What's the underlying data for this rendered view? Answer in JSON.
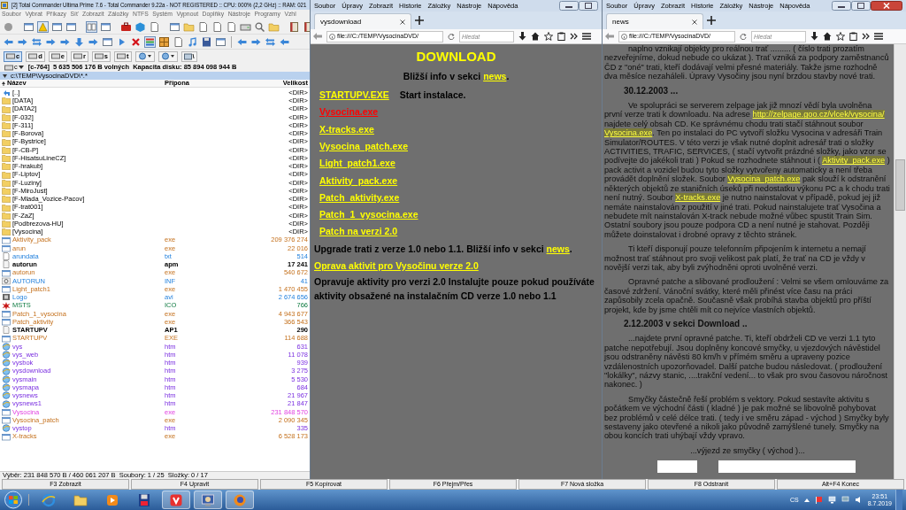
{
  "total_commander": {
    "title": "[2] Total Commander Ultima Prime 7.6 - Total Commander 9.22a - NOT REGISTERED :: CPU: 000% (2,2 GHz) :: RAM: 021",
    "menu": [
      "Soubor",
      "Vybrat",
      "Příkazy",
      "Síť",
      "Zobrazit",
      "Záložky",
      "NTFS",
      "Systém",
      "Vypnout",
      "Doplňky",
      "Nástroje",
      "Programy",
      "Vzhl"
    ],
    "drives": [
      {
        "label": "c",
        "selected": true
      },
      {
        "label": "d",
        "selected": false
      },
      {
        "label": "e",
        "selected": false
      },
      {
        "label": "r",
        "selected": false
      },
      {
        "label": "s",
        "selected": false
      },
      {
        "label": "t",
        "selected": false
      }
    ],
    "root_button": "\\",
    "drive_combo": "c",
    "free_space": "[c-764]  5 635 506 176 B volných  Kapacita disku: 85 894 098 944 B",
    "path": "c:\\TEMP\\VysocinaDVD\\*.*",
    "columns": [
      "Název",
      "Přípona",
      "Velikost"
    ],
    "files": [
      {
        "name": "[..]",
        "size": "<DIR>",
        "kind": "parent",
        "selected": false
      },
      {
        "name": "[DATA]",
        "size": "<DIR>",
        "kind": "folder",
        "selected": false
      },
      {
        "name": "[DATA2]",
        "size": "<DIR>",
        "kind": "folder",
        "selected": false
      },
      {
        "name": "[F-032]",
        "size": "<DIR>",
        "kind": "folder",
        "selected": false
      },
      {
        "name": "[F-311]",
        "size": "<DIR>",
        "kind": "folder",
        "selected": false
      },
      {
        "name": "[F-Borova]",
        "size": "<DIR>",
        "kind": "folder",
        "selected": false
      },
      {
        "name": "[F-Bystrice]",
        "size": "<DIR>",
        "kind": "folder",
        "selected": false
      },
      {
        "name": "[F-CB-P]",
        "size": "<DIR>",
        "kind": "folder",
        "selected": false
      },
      {
        "name": "[F-HisatsuLineCZ]",
        "size": "<DIR>",
        "kind": "folder",
        "selected": false
      },
      {
        "name": "[F-hrakub]",
        "size": "<DIR>",
        "kind": "folder",
        "selected": false
      },
      {
        "name": "[F-Liptov]",
        "size": "<DIR>",
        "kind": "folder",
        "selected": false
      },
      {
        "name": "[F-Luziny]",
        "size": "<DIR>",
        "kind": "folder",
        "selected": false
      },
      {
        "name": "[F-MiroJust]",
        "size": "<DIR>",
        "kind": "folder",
        "selected": false
      },
      {
        "name": "[F-Mlada_Vozice-Pacov]",
        "size": "<DIR>",
        "kind": "folder",
        "selected": false
      },
      {
        "name": "[F-trat001]",
        "size": "<DIR>",
        "kind": "folder",
        "selected": false
      },
      {
        "name": "[F-ZaZ]",
        "size": "<DIR>",
        "kind": "folder",
        "selected": false
      },
      {
        "name": "[Podbrezova-HU]",
        "size": "<DIR>",
        "kind": "folder",
        "selected": false
      },
      {
        "name": "[Vysocina]",
        "size": "<DIR>",
        "kind": "folder",
        "selected": false
      },
      {
        "name": "Aktivity_pack",
        "ext": "exe",
        "size": "209 376 274",
        "kind": "program",
        "selected": false
      },
      {
        "name": "arun",
        "ext": "exe",
        "size": "22 016",
        "kind": "program",
        "selected": false
      },
      {
        "name": "arundata",
        "ext": "txt",
        "size": "514",
        "kind": "text",
        "selected": false
      },
      {
        "name": "autorun",
        "ext": "apm",
        "size": "17 241",
        "kind": "document",
        "selected": false
      },
      {
        "name": "autorun",
        "ext": "exe",
        "size": "540 672",
        "kind": "program",
        "selected": false
      },
      {
        "name": "AUTORUN",
        "ext": "INF",
        "size": "41",
        "kind": "settings",
        "selected": false
      },
      {
        "name": "Light_patch1",
        "ext": "exe",
        "size": "1 470 455",
        "kind": "program",
        "selected": false
      },
      {
        "name": "Logo",
        "ext": "avi",
        "size": "2 674 656",
        "kind": "video",
        "selected": false
      },
      {
        "name": "MSTS",
        "ext": "ICO",
        "size": "766",
        "kind": "image",
        "selected": false
      },
      {
        "name": "Patch_1_vysocina",
        "ext": "exe",
        "size": "4 943 677",
        "kind": "program",
        "selected": false
      },
      {
        "name": "Patch_aktivity",
        "ext": "exe",
        "size": "366 543",
        "kind": "program",
        "selected": false
      },
      {
        "name": "STARTUPV",
        "ext": "AP1",
        "size": "290",
        "kind": "document",
        "selected": false
      },
      {
        "name": "STARTUPV",
        "ext": "EXE",
        "size": "114 688",
        "kind": "program",
        "selected": false
      },
      {
        "name": "vys",
        "ext": "htm",
        "size": "631",
        "kind": "webpage",
        "selected": false
      },
      {
        "name": "vys_web",
        "ext": "htm",
        "size": "11 078",
        "kind": "webpage",
        "selected": false
      },
      {
        "name": "vysbok",
        "ext": "htm",
        "size": "939",
        "kind": "webpage",
        "selected": false
      },
      {
        "name": "vysdownload",
        "ext": "htm",
        "size": "3 275",
        "kind": "webpage",
        "selected": false
      },
      {
        "name": "vysmain",
        "ext": "htm",
        "size": "5 530",
        "kind": "webpage",
        "selected": false
      },
      {
        "name": "vysmapa",
        "ext": "htm",
        "size": "684",
        "kind": "webpage",
        "selected": false
      },
      {
        "name": "vysnews",
        "ext": "htm",
        "size": "21 967",
        "kind": "webpage",
        "selected": false
      },
      {
        "name": "vysnews1",
        "ext": "htm",
        "size": "21 847",
        "kind": "webpage",
        "selected": false
      },
      {
        "name": "Vysocina",
        "ext": "exe",
        "size": "231 848 570",
        "kind": "program",
        "selected": true
      },
      {
        "name": "Vysocina_patch",
        "ext": "exe",
        "size": "2 090 345",
        "kind": "program",
        "selected": false
      },
      {
        "name": "vystop",
        "ext": "htm",
        "size": "335",
        "kind": "webpage",
        "selected": false
      },
      {
        "name": "X-tracks",
        "ext": "exe",
        "size": "6 528 173",
        "kind": "program",
        "selected": false
      }
    ],
    "status": "Výběr: 231 848 570 B / 460 061 207 B  Soubory: 1 / 25  Složky: 0 / 17",
    "function_keys": [
      "F3 Zobrazit",
      "F4 Upravit",
      "F5 Kopírovat",
      "F6 Přejm/Přes",
      "F7 Nová složka",
      "F8 Odstranit",
      "Alt+F4 Konec"
    ]
  },
  "browsers": [
    {
      "menu": [
        "Soubor",
        "Úpravy",
        "Zobrazit",
        "Historie",
        "Záložky",
        "Nástroje",
        "Nápověda"
      ],
      "tab": "vysdownload",
      "url": "file:///C:/TEMP/VysocinaDVD/",
      "search_placeholder": "Hledat",
      "close_button": false
    },
    {
      "menu": [
        "Soubor",
        "Úpravy",
        "Zobrazit",
        "Historie",
        "Záložky",
        "Nástroje",
        "Nápověda"
      ],
      "tab": "news",
      "url": "file:///C:/TEMP/VysocinaDVD/",
      "search_placeholder": "Hledat",
      "close_button": true
    }
  ],
  "download_page": {
    "heading": "DOWNLOAD",
    "intro": [
      {
        "kind": "text",
        "text": "Bližší info v sekci "
      },
      {
        "kind": "link",
        "text": "news"
      },
      {
        "kind": "text",
        "text": "."
      }
    ],
    "files": [
      {
        "label": "STARTUPV.EXE",
        "note": "Start instalace.",
        "color": "#ffff00"
      },
      {
        "label": "Vysocina.exe",
        "color": "#ff0000"
      },
      {
        "label": "X-tracks.exe",
        "color": "#ffff00"
      },
      {
        "label": "Vysocina_patch.exe",
        "color": "#ffff00"
      },
      {
        "label": "Light_patch1.exe",
        "color": "#ffff00"
      },
      {
        "label": "Aktivity_pack.exe",
        "color": "#ffff00"
      },
      {
        "label": "Patch_aktivity.exe",
        "color": "#ffff00"
      },
      {
        "label": "Patch_1_vysocina.exe",
        "color": "#ffff00"
      },
      {
        "label": "Patch na verzi 2.0",
        "color": "#ffff00"
      }
    ],
    "upgrade": [
      {
        "kind": "text",
        "text": "Upgrade trati z verze 1.0 nebo 1.1. Bližší info v sekci "
      },
      {
        "kind": "link",
        "text": "news"
      },
      {
        "kind": "text",
        "text": "."
      }
    ],
    "fix_link": "Oprava aktivit pro Vysočinu verze 2.0",
    "fix_note": "Opravuje aktivity pro verzi 2.0 Instalujte pouze pokud používáte aktivity obsažené na instalačním CD verze 1.0 nebo 1.1"
  },
  "news_page": {
    "blocks": [
      {
        "kind": "paragraph",
        "segments": [
          {
            "kind": "text",
            "text": "naplno vznikají objekty pro reálnou trať ......... ( číslo trati prozatím nezveřejníme, dokud nebude co ukázat ). Trať vzniká za podpory zaměstnanců ČD z \"oné\" trati, kteří dodávají velmi přesné materiály. Takže jsme rozhodně dva měsíce nezaháleli. Úpravy Vysočiny jsou nyní brzdou stavby nové trati."
          }
        ]
      },
      {
        "kind": "date",
        "text": "30.12.2003 ..."
      },
      {
        "kind": "paragraph",
        "segments": [
          {
            "kind": "text",
            "text": "Ve spolupráci se serverem zelpage jak již mnozí vědí byla uvolněna první verze trati k downloadu. Na adrese "
          },
          {
            "kind": "link",
            "text": "http://zelpage.goo.cz/vlcek/vysocina/"
          },
          {
            "kind": "text",
            "text": "  najdete celý obsah CD. Ke správnému chodu trati stačí stáhnout soubor "
          },
          {
            "kind": "link",
            "text": "Vysocina.exe"
          },
          {
            "kind": "text",
            "text": ". Ten po instalaci do PC vytvoří složku Vysocina v adresáři Train Simulator/ROUTES. V této verzi je však nutné doplnit adresář trati o složky ACTIVITIES, TRAFIC, SERVICES, ( stačí vytvořit prázdné složky, jako vzor se podívejte do jakékoli trati ) Pokud se rozhodnete stáhnout i ( "
          },
          {
            "kind": "link",
            "text": "Aktivity_pack.exe"
          },
          {
            "kind": "text",
            "text": " ) pack activit a vozidel budou tyto složky vytvořeny automaticky a není třeba provádět doplnění složek. Soubor "
          },
          {
            "kind": "link",
            "text": "Vysocina_patch.exe"
          },
          {
            "kind": "text",
            "text": " pak slouží k odstranění některých objektů ze staničních úseků při nedostatku výkonu PC a k chodu trati není nutný. Soubor "
          },
          {
            "kind": "link",
            "text": "X-tracks.exe"
          },
          {
            "kind": "text",
            "text": " je nutno nainstalovat v případě, pokud jej již nemáte nainstalován z použití v jiné trati. Pokud nainstalujete trať Vysočina a nebudete mít nainstalován X-track nebude možné vůbec spustit Train Sim. Ostatní soubory jsou pouze podpora CD a není nutné je stahovat. Později můžete doinstalovat i drobné opravy z těchto stránek."
          }
        ]
      },
      {
        "kind": "paragraph",
        "segments": [
          {
            "kind": "text",
            "text": "Ti kteří disponují pouze telefonním připojením k internetu a nemají možnost trať stáhnout pro svoji velikost pak platí, že trať na CD je vždy v novější verzi tak, aby byli zvýhodněni oproti uvolněné verzi."
          }
        ]
      },
      {
        "kind": "paragraph",
        "segments": [
          {
            "kind": "text",
            "text": "Opravné patche a slibované prodloužení :  Velmi se všem omlouváme za časové zdržení. Vánoční svátky, které měli přinést více času na práci zapůsobily zcela opačně. Současně však probíhá stavba objektů pro příští projekt, kde by jsme chtěli mít co nejvíce vlastních objektů."
          }
        ]
      },
      {
        "kind": "date",
        "text": "2.12.2003 v sekci Download .."
      },
      {
        "kind": "paragraph",
        "segments": [
          {
            "kind": "text",
            "text": "...najdete první opravné patche. Ti, kteří obdrželi CD ve verzi 1.1 tyto patche nepotřebují. Jsou doplněny koncové smyčky, u vjezdových návěstidel jsou odstraněny návěsti 80 km/h v přímém směru a upraveny pozice vzdálenostních upozorňovadel. Další patche budou následovat. ( prodloužení \"lokálky\", názvy stanic, ....trakční vedení... to však pro svou časovou náročnost nakonec. )"
          }
        ]
      },
      {
        "kind": "paragraph",
        "segments": [
          {
            "kind": "text",
            "text": "Smyčky částečně řeší problém s vektory. Pokud sestavíte aktivitu s počátkem ve východní části ( kladné ) je pak možné se libovolně pohybovat bez problémů v celé délce trati. ( tedy i ve směru západ - východ ) Smyčky byly sestaveny jako otevřené a nikoli jako původně zamýšlené tunely. Smyčky na obou koncích trati uhýbají vždy vpravo."
          }
        ]
      },
      {
        "kind": "caption",
        "text": "...výjezd ze smyčky ( východ )..."
      }
    ]
  },
  "taskbar": {
    "apps": [
      {
        "kind": "globe",
        "running": false
      },
      {
        "kind": "folder",
        "running": false
      },
      {
        "kind": "player",
        "running": false
      },
      {
        "kind": "floppy",
        "running": false
      },
      {
        "kind": "chevron",
        "running": true
      },
      {
        "kind": "monitor",
        "running": true
      },
      {
        "kind": "orb",
        "running": true
      }
    ],
    "language": "CS",
    "time": "23:51",
    "date": "8.7.2019"
  }
}
